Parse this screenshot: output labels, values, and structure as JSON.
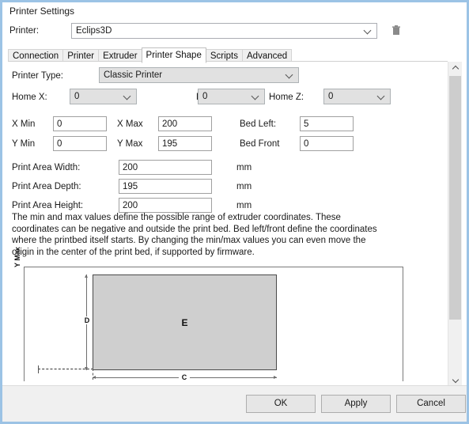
{
  "window": {
    "title": "Printer Settings"
  },
  "printer_selector": {
    "label": "Printer:",
    "value": "Eclips3D",
    "delete_icon": "trash-icon",
    "dropdown_icon": "chevron-down-icon"
  },
  "tabs": [
    {
      "label": "Connection",
      "selected": false
    },
    {
      "label": "Printer",
      "selected": false
    },
    {
      "label": "Extruder",
      "selected": false
    },
    {
      "label": "Printer Shape",
      "selected": true
    },
    {
      "label": "Scripts",
      "selected": false
    },
    {
      "label": "Advanced",
      "selected": false
    }
  ],
  "form": {
    "printer_type": {
      "label": "Printer Type:",
      "value": "Classic Printer"
    },
    "home_x": {
      "label": "Home X:",
      "value": "0"
    },
    "home_y": {
      "label": "Home Y:",
      "value": "0"
    },
    "home_z": {
      "label": "Home Z:",
      "value": "0"
    },
    "x_min": {
      "label": "X Min",
      "value": "0"
    },
    "x_max": {
      "label": "X Max",
      "value": "200"
    },
    "bed_left": {
      "label": "Bed Left:",
      "value": "5"
    },
    "y_min": {
      "label": "Y Min",
      "value": "0"
    },
    "y_max": {
      "label": "Y Max",
      "value": "195"
    },
    "bed_front": {
      "label": "Bed Front",
      "value": "0"
    },
    "print_area_width": {
      "label": "Print Area Width:",
      "value": "200",
      "unit": "mm"
    },
    "print_area_depth": {
      "label": "Print Area Depth:",
      "value": "195",
      "unit": "mm"
    },
    "print_area_height": {
      "label": "Print Area Height:",
      "value": "200",
      "unit": "mm"
    }
  },
  "description": "The min and max values define the possible range of extruder coordinates. These coordinates can be negative and outside the print bed. Bed left/front define the coordinates where the printbed itself starts. By changing the min/max values you can even move the origin in the center of the print bed, if supported by firmware.",
  "diagram": {
    "y_axis_label": "Y Max",
    "bed_label": "E",
    "vertical_dim_label": "D",
    "horizontal_dim_label": "C"
  },
  "scrollbar": {
    "up_icon": "chevron-up-icon",
    "down_icon": "chevron-down-icon"
  },
  "footer": {
    "ok": "OK",
    "apply": "Apply",
    "cancel": "Cancel"
  },
  "colors": {
    "window_border": "#9cc3e5",
    "footer_bg": "#f0f0f0",
    "bed_fill": "#cfcfcf",
    "dropdown_bg": "#e1e1e1"
  }
}
